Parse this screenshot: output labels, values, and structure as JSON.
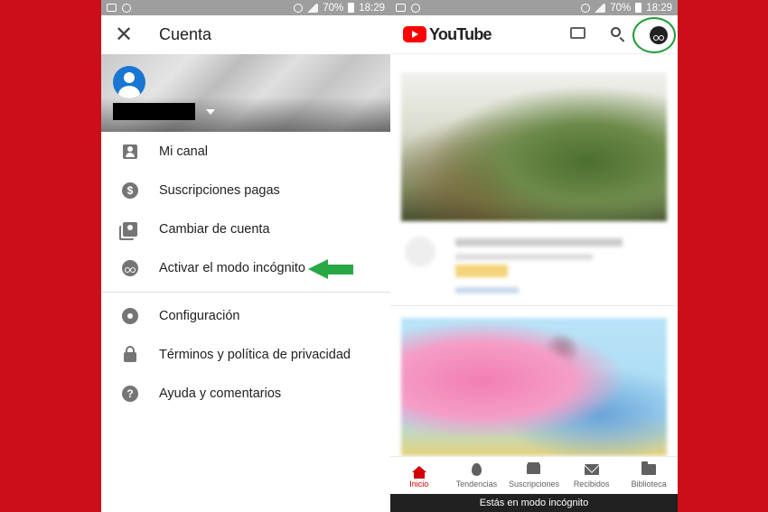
{
  "status_bar": {
    "battery": "70%",
    "time": "18:29"
  },
  "left_panel": {
    "header": {
      "title": "Cuenta",
      "close_icon": "close-icon"
    },
    "account": {
      "avatar_icon": "avatar-icon",
      "name_redacted": true
    },
    "menu": [
      {
        "label": "Mi canal",
        "icon": "person-icon"
      },
      {
        "label": "Suscripciones pagas",
        "icon": "dollar-icon"
      },
      {
        "label": "Cambiar de cuenta",
        "icon": "switch-account-icon"
      },
      {
        "label": "Activar el modo incógnito",
        "icon": "incognito-icon"
      }
    ],
    "menu2": [
      {
        "label": "Configuración",
        "icon": "gear-icon"
      },
      {
        "label": "Términos y política de privacidad",
        "icon": "lock-icon"
      },
      {
        "label": "Ayuda y comentarios",
        "icon": "help-icon"
      }
    ],
    "colors": {
      "arrow": "#28a745"
    }
  },
  "right_panel": {
    "logo_text": "YouTube",
    "bottom_nav": [
      {
        "label": "Inicio",
        "icon": "home-icon",
        "active": true
      },
      {
        "label": "Tendencias",
        "icon": "flame-icon"
      },
      {
        "label": "Suscripciones",
        "icon": "subscriptions-icon"
      },
      {
        "label": "Recibidos",
        "icon": "mail-icon"
      },
      {
        "label": "Biblioteca",
        "icon": "folder-icon"
      }
    ],
    "incognito_banner": "Estás en modo incógnito",
    "colors": {
      "brand": "#ff0000",
      "active_nav": "#d20000",
      "highlight": "#1f9d38"
    }
  },
  "background_color": "#cc0e1a"
}
